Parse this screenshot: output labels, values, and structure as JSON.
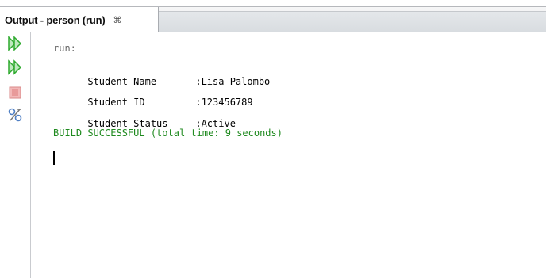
{
  "tab": {
    "title": "Output - person (run)",
    "close_glyph": "⌘"
  },
  "toolbar": {
    "buttons": [
      {
        "name": "rerun-icon",
        "color": "#2faa2f"
      },
      {
        "name": "rerun-modified-icon",
        "color": "#2faa2f"
      },
      {
        "name": "stop-icon",
        "color": "#e06a6a"
      },
      {
        "name": "settings-icon",
        "color": "#5a8ad0"
      }
    ]
  },
  "console": {
    "run_line": "run:",
    "rows": [
      {
        "label": "Student Name",
        "value": ":Lisa Palombo"
      },
      {
        "label": "Student ID",
        "value": ":123456789"
      },
      {
        "label": "Student Status",
        "value": ":Active"
      }
    ],
    "build_line": "BUILD SUCCESSFUL (total time: 9 seconds)"
  }
}
